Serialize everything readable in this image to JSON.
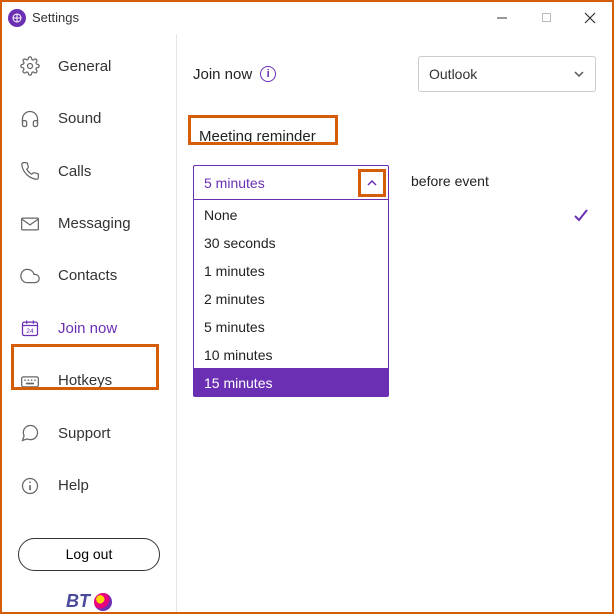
{
  "titlebar": {
    "title": "Settings"
  },
  "sidebar": {
    "items": [
      {
        "label": "General"
      },
      {
        "label": "Sound"
      },
      {
        "label": "Calls"
      },
      {
        "label": "Messaging"
      },
      {
        "label": "Contacts"
      },
      {
        "label": "Join now"
      },
      {
        "label": "Hotkeys"
      },
      {
        "label": "Support"
      },
      {
        "label": "Help"
      }
    ],
    "logout": "Log out",
    "brand": "BT"
  },
  "main": {
    "joinnow_label": "Join now",
    "calendar_select": "Outlook",
    "section_label": "Meeting reminder",
    "reminder_selected": "5 minutes",
    "reminder_options": [
      "None",
      "30 seconds",
      "1 minutes",
      "2 minutes",
      "5 minutes",
      "10 minutes",
      "15 minutes"
    ],
    "before_label": "before event"
  }
}
